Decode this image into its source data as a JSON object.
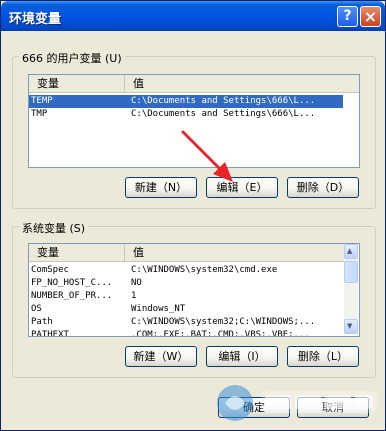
{
  "window": {
    "title": "环境变量"
  },
  "title_buttons": {
    "help": "?",
    "close": "×"
  },
  "user_vars": {
    "group_label": "666 的用户变量",
    "group_accel": "(U)",
    "columns": [
      "变量",
      "值"
    ],
    "rows": [
      {
        "name": "TEMP",
        "value": "C:\\Documents and Settings\\666\\L..."
      },
      {
        "name": "TMP",
        "value": "C:\\Documents and Settings\\666\\L..."
      }
    ],
    "buttons": {
      "new": "新建（N）",
      "edit": "编辑（E）",
      "delete": "删除（D）"
    }
  },
  "system_vars": {
    "group_label": "系统变量",
    "group_accel": "(S)",
    "columns": [
      "变量",
      "值"
    ],
    "rows": [
      {
        "name": "ComSpec",
        "value": "C:\\WINDOWS\\system32\\cmd.exe"
      },
      {
        "name": "FP_NO_HOST_C...",
        "value": "NO"
      },
      {
        "name": "NUMBER_OF_PR...",
        "value": "1"
      },
      {
        "name": "OS",
        "value": "Windows_NT"
      },
      {
        "name": "Path",
        "value": "C:\\WINDOWS\\system32;C:\\WINDOWS;..."
      },
      {
        "name": "PATHEXT",
        "value": ".COM;.EXE;.BAT;.CMD;.VBS;.VBE;..."
      }
    ],
    "buttons": {
      "new": "新建（W）",
      "edit": "编辑（I）",
      "delete": "删除（L）"
    }
  },
  "footer_buttons": {
    "ok": "确定",
    "cancel": "取消"
  },
  "colors": {
    "selection": "#316ac5",
    "titlebar": "#0054e3",
    "annotation": "#e8262a"
  }
}
